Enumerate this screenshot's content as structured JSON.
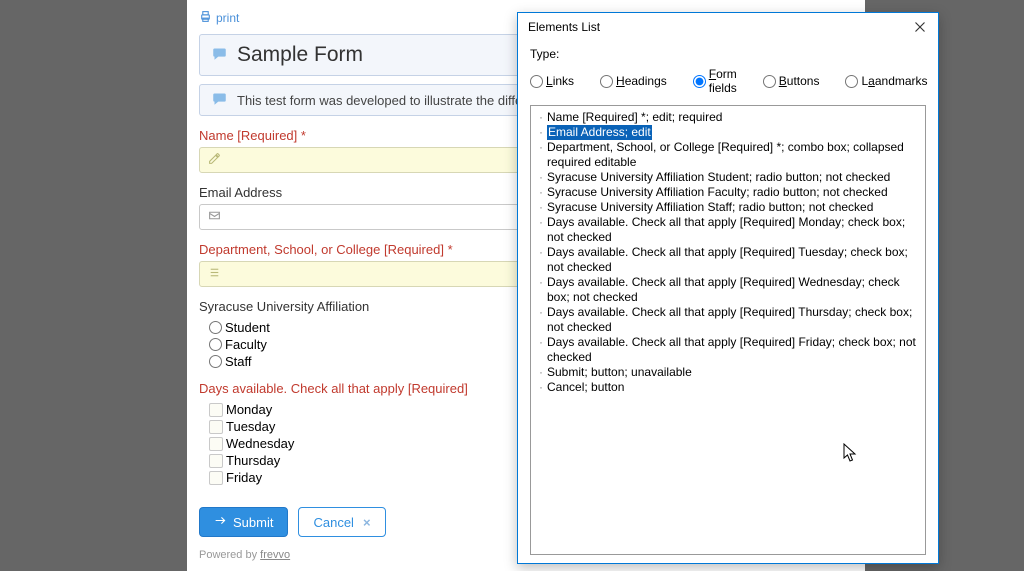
{
  "print": {
    "label": "print"
  },
  "form": {
    "title": "Sample Form",
    "description": "This test form was developed to illustrate the different types",
    "name_label": "Name [Required] *",
    "email_label": "Email Address",
    "dept_label": "Department, School, or College [Required] *",
    "affiliation_label": "Syracuse University Affiliation",
    "affiliation_options": {
      "student": "Student",
      "faculty": "Faculty",
      "staff": "Staff"
    },
    "days_label": "Days available. Check all that apply [Required]",
    "days": {
      "mon": "Monday",
      "tue": "Tuesday",
      "wed": "Wednesday",
      "thu": "Thursday",
      "fri": "Friday"
    },
    "submit_label": "Submit",
    "cancel_label": "Cancel",
    "powered_prefix": "Powered by ",
    "powered_link": "frevvo"
  },
  "dialog": {
    "title": "Elements List",
    "type_label": "Type:",
    "types": {
      "links": "inks",
      "headings": "eadings",
      "form_fields": "orm fields",
      "buttons": "uttons",
      "landmarks": "andmarks"
    },
    "items": [
      {
        "text": "Name [Required] *; edit; required",
        "selected": false
      },
      {
        "text": "Email Address; edit",
        "selected": true
      },
      {
        "text": "Department, School, or College [Required] *; combo box; collapsed required editable",
        "selected": false
      },
      {
        "text": "Syracuse University Affiliation Student; radio button; not checked",
        "selected": false
      },
      {
        "text": "Syracuse University Affiliation Faculty; radio button; not checked",
        "selected": false
      },
      {
        "text": "Syracuse University Affiliation Staff; radio button; not checked",
        "selected": false
      },
      {
        "text": "Days available. Check all that apply [Required] Monday; check box; not checked",
        "selected": false
      },
      {
        "text": "Days available. Check all that apply [Required] Tuesday; check box; not checked",
        "selected": false
      },
      {
        "text": "Days available. Check all that apply [Required] Wednesday; check box; not checked",
        "selected": false
      },
      {
        "text": "Days available. Check all that apply [Required] Thursday; check box; not checked",
        "selected": false
      },
      {
        "text": "Days available. Check all that apply [Required] Friday; check box; not checked",
        "selected": false
      },
      {
        "text": "Submit; button; unavailable",
        "selected": false
      },
      {
        "text": "Cancel; button",
        "selected": false
      }
    ]
  }
}
